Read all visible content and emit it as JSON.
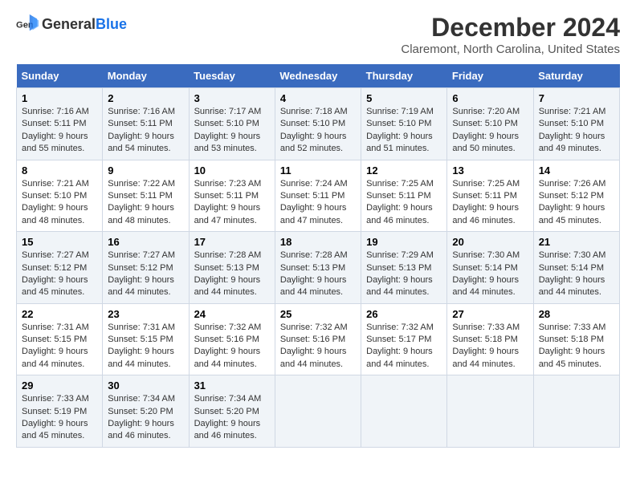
{
  "logo": {
    "text_general": "General",
    "text_blue": "Blue"
  },
  "title": "December 2024",
  "subtitle": "Claremont, North Carolina, United States",
  "days_of_week": [
    "Sunday",
    "Monday",
    "Tuesday",
    "Wednesday",
    "Thursday",
    "Friday",
    "Saturday"
  ],
  "weeks": [
    [
      {
        "day": "1",
        "sunrise": "7:16 AM",
        "sunset": "5:11 PM",
        "daylight": "9 hours and 55 minutes."
      },
      {
        "day": "2",
        "sunrise": "7:16 AM",
        "sunset": "5:11 PM",
        "daylight": "9 hours and 54 minutes."
      },
      {
        "day": "3",
        "sunrise": "7:17 AM",
        "sunset": "5:10 PM",
        "daylight": "9 hours and 53 minutes."
      },
      {
        "day": "4",
        "sunrise": "7:18 AM",
        "sunset": "5:10 PM",
        "daylight": "9 hours and 52 minutes."
      },
      {
        "day": "5",
        "sunrise": "7:19 AM",
        "sunset": "5:10 PM",
        "daylight": "9 hours and 51 minutes."
      },
      {
        "day": "6",
        "sunrise": "7:20 AM",
        "sunset": "5:10 PM",
        "daylight": "9 hours and 50 minutes."
      },
      {
        "day": "7",
        "sunrise": "7:21 AM",
        "sunset": "5:10 PM",
        "daylight": "9 hours and 49 minutes."
      }
    ],
    [
      {
        "day": "8",
        "sunrise": "7:21 AM",
        "sunset": "5:10 PM",
        "daylight": "9 hours and 48 minutes."
      },
      {
        "day": "9",
        "sunrise": "7:22 AM",
        "sunset": "5:11 PM",
        "daylight": "9 hours and 48 minutes."
      },
      {
        "day": "10",
        "sunrise": "7:23 AM",
        "sunset": "5:11 PM",
        "daylight": "9 hours and 47 minutes."
      },
      {
        "day": "11",
        "sunrise": "7:24 AM",
        "sunset": "5:11 PM",
        "daylight": "9 hours and 47 minutes."
      },
      {
        "day": "12",
        "sunrise": "7:25 AM",
        "sunset": "5:11 PM",
        "daylight": "9 hours and 46 minutes."
      },
      {
        "day": "13",
        "sunrise": "7:25 AM",
        "sunset": "5:11 PM",
        "daylight": "9 hours and 46 minutes."
      },
      {
        "day": "14",
        "sunrise": "7:26 AM",
        "sunset": "5:12 PM",
        "daylight": "9 hours and 45 minutes."
      }
    ],
    [
      {
        "day": "15",
        "sunrise": "7:27 AM",
        "sunset": "5:12 PM",
        "daylight": "9 hours and 45 minutes."
      },
      {
        "day": "16",
        "sunrise": "7:27 AM",
        "sunset": "5:12 PM",
        "daylight": "9 hours and 44 minutes."
      },
      {
        "day": "17",
        "sunrise": "7:28 AM",
        "sunset": "5:13 PM",
        "daylight": "9 hours and 44 minutes."
      },
      {
        "day": "18",
        "sunrise": "7:28 AM",
        "sunset": "5:13 PM",
        "daylight": "9 hours and 44 minutes."
      },
      {
        "day": "19",
        "sunrise": "7:29 AM",
        "sunset": "5:13 PM",
        "daylight": "9 hours and 44 minutes."
      },
      {
        "day": "20",
        "sunrise": "7:30 AM",
        "sunset": "5:14 PM",
        "daylight": "9 hours and 44 minutes."
      },
      {
        "day": "21",
        "sunrise": "7:30 AM",
        "sunset": "5:14 PM",
        "daylight": "9 hours and 44 minutes."
      }
    ],
    [
      {
        "day": "22",
        "sunrise": "7:31 AM",
        "sunset": "5:15 PM",
        "daylight": "9 hours and 44 minutes."
      },
      {
        "day": "23",
        "sunrise": "7:31 AM",
        "sunset": "5:15 PM",
        "daylight": "9 hours and 44 minutes."
      },
      {
        "day": "24",
        "sunrise": "7:32 AM",
        "sunset": "5:16 PM",
        "daylight": "9 hours and 44 minutes."
      },
      {
        "day": "25",
        "sunrise": "7:32 AM",
        "sunset": "5:16 PM",
        "daylight": "9 hours and 44 minutes."
      },
      {
        "day": "26",
        "sunrise": "7:32 AM",
        "sunset": "5:17 PM",
        "daylight": "9 hours and 44 minutes."
      },
      {
        "day": "27",
        "sunrise": "7:33 AM",
        "sunset": "5:18 PM",
        "daylight": "9 hours and 44 minutes."
      },
      {
        "day": "28",
        "sunrise": "7:33 AM",
        "sunset": "5:18 PM",
        "daylight": "9 hours and 45 minutes."
      }
    ],
    [
      {
        "day": "29",
        "sunrise": "7:33 AM",
        "sunset": "5:19 PM",
        "daylight": "9 hours and 45 minutes."
      },
      {
        "day": "30",
        "sunrise": "7:34 AM",
        "sunset": "5:20 PM",
        "daylight": "9 hours and 46 minutes."
      },
      {
        "day": "31",
        "sunrise": "7:34 AM",
        "sunset": "5:20 PM",
        "daylight": "9 hours and 46 minutes."
      },
      null,
      null,
      null,
      null
    ]
  ],
  "labels": {
    "sunrise": "Sunrise:",
    "sunset": "Sunset:",
    "daylight": "Daylight:"
  }
}
